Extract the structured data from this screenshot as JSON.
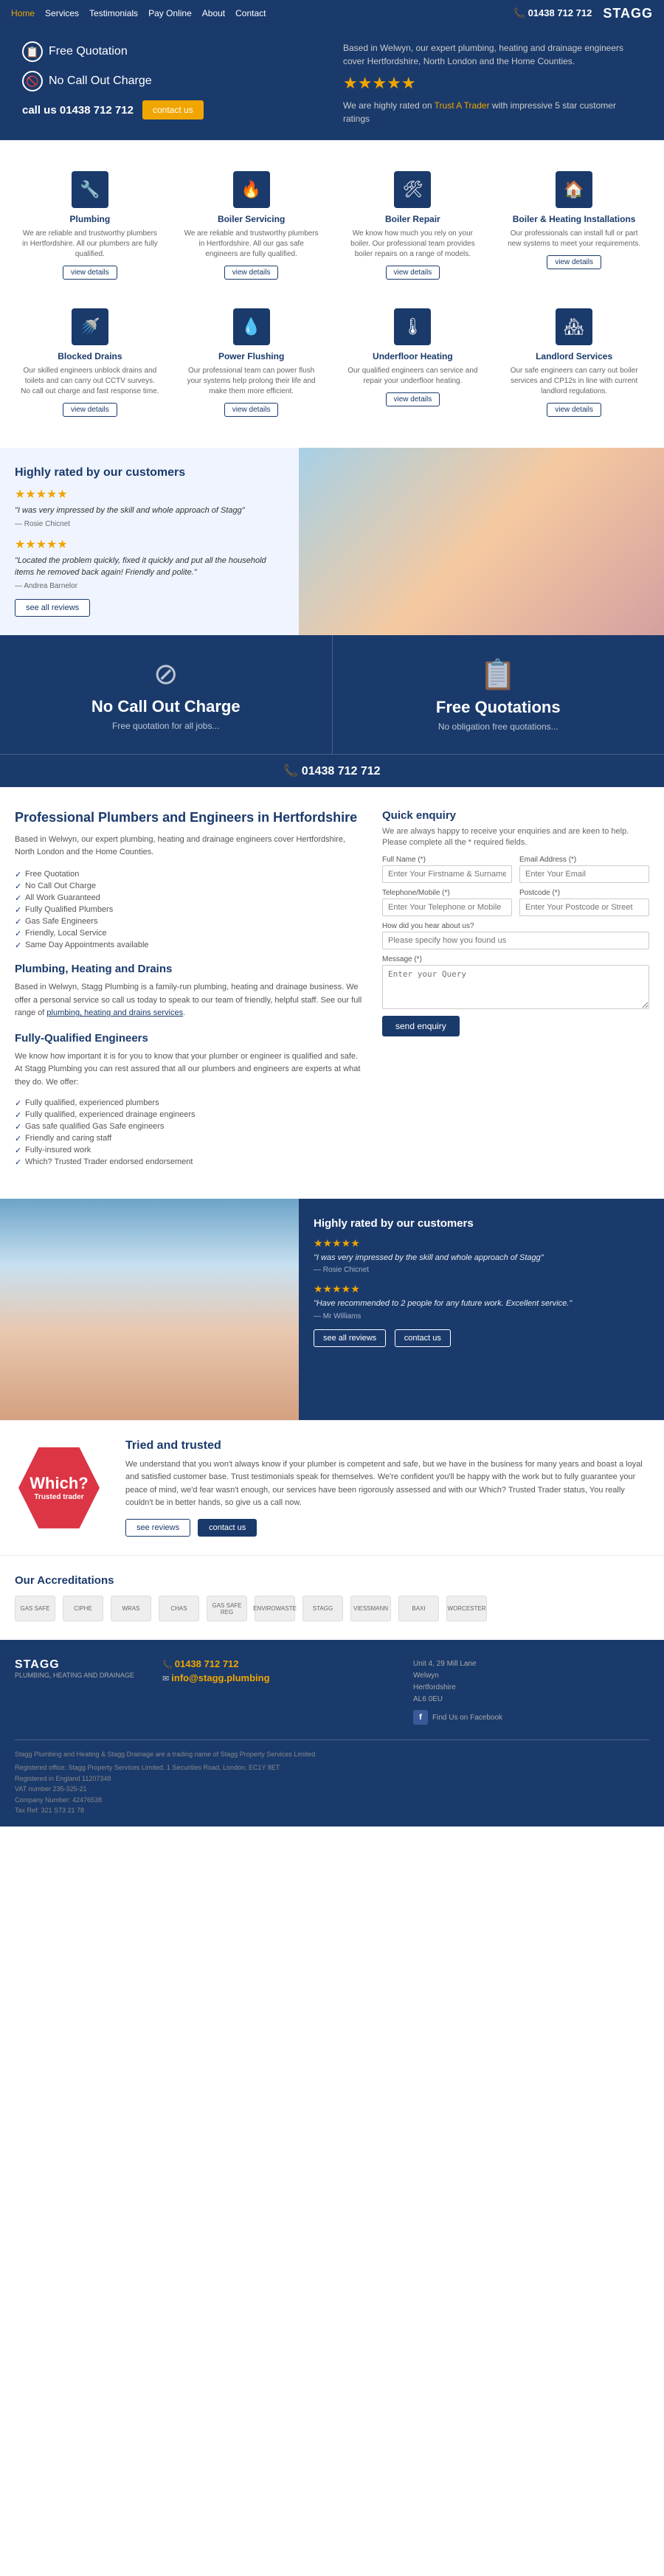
{
  "nav": {
    "links": [
      "Home",
      "Services",
      "Testimonials",
      "Pay Online",
      "About",
      "Contact"
    ],
    "activeLink": "Home",
    "phone": "01438 712 712",
    "logo": "STAGG"
  },
  "hero": {
    "badge1": "Free Quotation",
    "badge2": "No Call Out Charge",
    "phoneLabel": "call us 01438 712 712",
    "contactBtn": "contact us",
    "intro": "Based in Welwyn, our expert plumbing, heating and drainage engineers cover Hertfordshire, North London and the Home Counties.",
    "trustText": "We are highly rated on",
    "trustLink": "Trust A Trader",
    "trustSuffix": "with impressive 5 star customer ratings",
    "stars": "★★★★★"
  },
  "services": [
    {
      "icon": "🔧",
      "title": "Plumbing",
      "desc": "We are reliable and trustworthy plumbers in Hertfordshire. All our plumbers are fully qualified.",
      "link": "view details"
    },
    {
      "icon": "🔥",
      "title": "Boiler Servicing",
      "desc": "We are reliable and trustworthy plumbers in Hertfordshire. All our gas safe engineers are fully qualified.",
      "link": "view details"
    },
    {
      "icon": "🛠",
      "title": "Boiler Repair",
      "desc": "We know how much you rely on your boiler. Our professional team provides boiler repairs on a range of models.",
      "link": "view details"
    },
    {
      "icon": "🏠",
      "title": "Boiler & Heating Installations",
      "desc": "Our professionals can install full or part new systems to meet your requirements.",
      "link": "view details"
    },
    {
      "icon": "🚿",
      "title": "Blocked Drains",
      "desc": "Our skilled engineers unblock drains and toilets and can carry out CCTV surveys. No call out charge and fast response time.",
      "link": "view details"
    },
    {
      "icon": "💧",
      "title": "Power Flushing",
      "desc": "Our professional team can power flush your systems help prolong their life and make them more efficient.",
      "link": "view details"
    },
    {
      "icon": "🌡",
      "title": "Underfloor Heating",
      "desc": "Our qualified engineers can service and repair your underfloor heating.",
      "link": "view details"
    },
    {
      "icon": "🏘",
      "title": "Landlord Services",
      "desc": "Our safe engineers can carry out boiler services and CP12s in line with current landlord regulations.",
      "link": "view details"
    }
  ],
  "testimonials_left": {
    "heading": "Highly rated by our customers",
    "stars1": "★★★★★",
    "quote1": "\"I was very impressed by the skill and whole approach of Stagg\"",
    "author1": "— Rosie Chicnet",
    "stars2": "★★★★★",
    "quote2": "\"Located the problem quickly, fixed it quickly and put all the household items he removed back again! Friendly and polite.\"",
    "author2": "— Andrea Barnelor",
    "seeAll": "see all reviews"
  },
  "banner": {
    "noCallout": "No Call Out Charge",
    "noCalloutSub": "Free quotation for all jobs...",
    "freeQuote": "Free Quotations",
    "freeQuoteSub": "No obligation free quotations...",
    "phone": "01438 712 712"
  },
  "main": {
    "title": "Professional Plumbers and Engineers in Hertfordshire",
    "intro": "Based in Welwyn, our expert plumbing, heating and drainage engineers cover Hertfordshire, North London and the Home Counties.",
    "usp": [
      "Free Quotation",
      "No Call Out Charge",
      "All Work Guaranteed",
      "Fully Qualified Plumbers",
      "Gas Safe Engineers",
      "Friendly, Local Service",
      "Same Day Appointments available"
    ],
    "section2Title": "Plumbing, Heating and Drains",
    "section2Text": "Based in Welwyn, Stagg Plumbing is a family-run plumbing, heating and drainage business. We offer a personal service so call us today to speak to our team of friendly, helpful staff. See our full range of plumbing, heating and drains services.",
    "linkText": "plumbing, heating and drains services",
    "section3Title": "Fully-Qualified Engineers",
    "section3Text": "We know how important it is for you to know that your plumber or engineer is qualified and safe. At Stagg Plumbing you can rest assured that all our plumbers and engineers are experts at what they do. We offer:",
    "fqList": [
      "Fully qualified, experienced plumbers",
      "Fully qualified, experienced drainage engineers",
      "Gas safe qualified Gas Safe engineers",
      "Friendly and caring staff",
      "Fully-insured work",
      "Which? Trusted Trader endorsed endorsement"
    ]
  },
  "quickEnquiry": {
    "title": "Quick enquiry",
    "intro": "We are always happy to receive your enquiries and are keen to help. Please complete all the * required fields.",
    "fullNameLabel": "Full Name (*)",
    "fullNamePlaceholder": "Enter Your Firstname & Surname",
    "emailLabel": "Email Address (*)",
    "emailPlaceholder": "Enter Your Email",
    "phoneLabel": "Telephone/Mobile (*)",
    "phonePlaceholder": "Enter Your Telephone or Mobile",
    "postcodeLabel": "Postcode (*)",
    "postcodePlaceholder": "Enter Your Postcode or Street",
    "howLabel": "How did you hear about us?",
    "howPlaceholder": "Please specify how you found us",
    "messageLabel": "Message (*)",
    "messagePlaceholder": "Enter your Query",
    "sendBtn": "send enquiry"
  },
  "lowerTestimonials": {
    "heading": "Highly rated by our customers",
    "stars1": "★★★★★",
    "quote1": "\"I was very impressed by the skill and whole approach of Stagg\"",
    "author1": "— Rosie Chicnet",
    "stars2": "★★★★★",
    "quote2": "\"Have recommended to 2 people for any future work. Excellent service.\"",
    "author2": "— Mr Williams",
    "seeReviews": "see all reviews",
    "contactUs": "contact us"
  },
  "which": {
    "badge1": "Which?",
    "badge2": "Trusted trader",
    "title": "Tried and trusted",
    "text": "We understand that you won't always know if your plumber is competent and safe, but we have in the business for many years and boast a loyal and satisfied customer base. Trust testimonials speak for themselves. We're confident you'll be happy with the work but to fully guarantee your peace of mind, we'd fear wasn't enough, our services have been rigorously assessed and with our Which? Trusted Trader status, You really couldn't be in better hands, so give us a call now.",
    "seeReviews": "see reviews",
    "contactUs": "contact us"
  },
  "accreditations": {
    "title": "Our Accreditations",
    "logos": [
      "GAS SAFE",
      "CIPHE",
      "WRAS",
      "CHAS",
      "GAS SAFE REG",
      "ENVIROWASTE",
      "STAGG",
      "VIESSMANN",
      "BAXI",
      "WORCESTER"
    ]
  },
  "footer": {
    "logo": "STAGG",
    "tagline": "PLUMBING, HEATING AND DRAINAGE",
    "phone": "01438 712 712",
    "email": "info@stagg.plumbing",
    "address": "Unit 4, 29 Mill Lane\nWelwyn\nHertfordshire\nAL6 0EU",
    "facebookText": "Find Us on Facebook",
    "copyright": "Stagg Plumbing and Heating & Stagg Drainage are a trading name of Stagg Property Services Limited",
    "regInfo": "Registered office: Stagg Property Services Limited, 1 Securities Road, London, EC1Y 8ET\nRegistered in England 11207348\nVAT number 235-325-21\nCompany Number: 42476538\nTax Ref: 321 S73 21 78"
  }
}
